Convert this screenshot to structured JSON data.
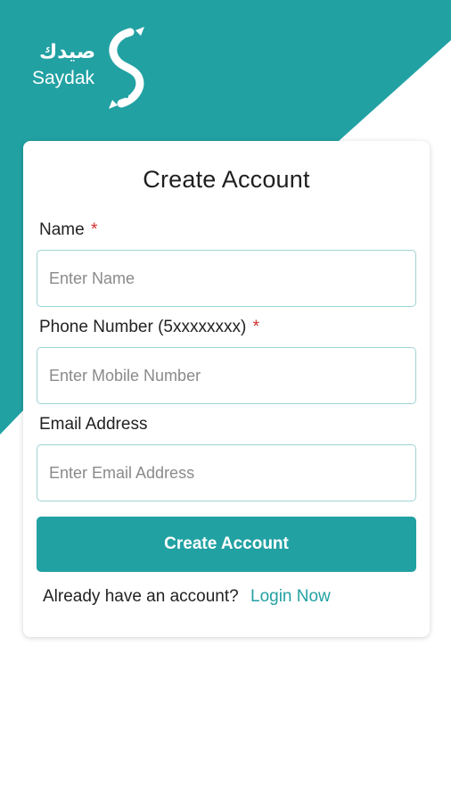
{
  "brand": {
    "arabic_name": "صيدك",
    "latin_name": "Saydak",
    "accent_color": "#22a1a3"
  },
  "form": {
    "title": "Create Account",
    "name_label": "Name",
    "name_required_mark": "*",
    "name_placeholder": "Enter Name",
    "phone_label": "Phone Number (5xxxxxxxx)",
    "phone_required_mark": "*",
    "phone_placeholder": "Enter Mobile Number",
    "email_label": "Email Address",
    "email_placeholder": "Enter Email Address",
    "submit_label": "Create Account",
    "footer_text": "Already have an account?",
    "login_link": "Login Now"
  }
}
